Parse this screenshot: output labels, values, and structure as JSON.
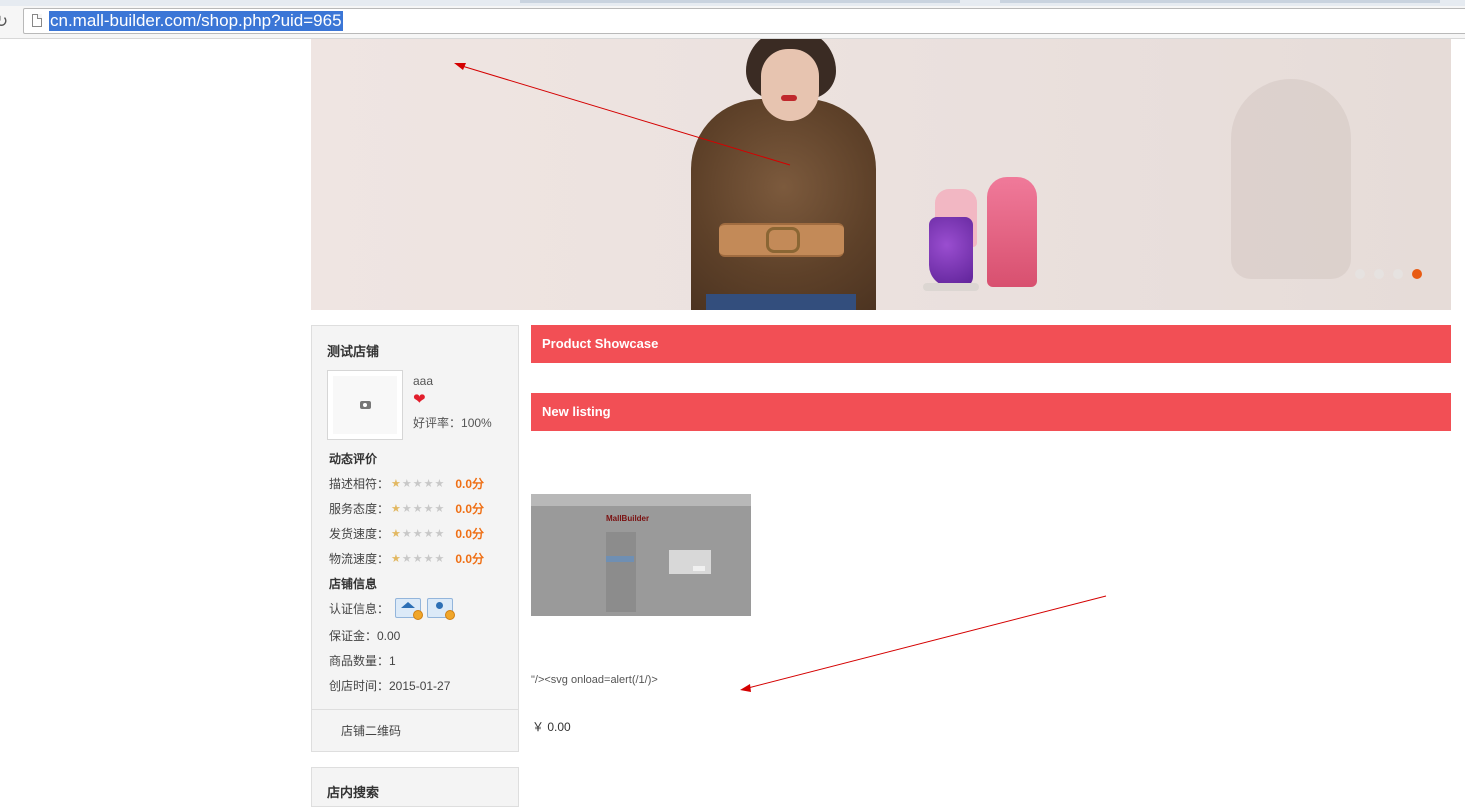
{
  "browser": {
    "url": "cn.mall-builder.com/shop.php?uid=965"
  },
  "banner": {
    "slide_count": 4,
    "active_slide": 4
  },
  "shop": {
    "name": "测试店铺",
    "owner": "aaa",
    "positive_rate_label": "好评率：",
    "positive_rate_value": "100%",
    "dynamic_rating_title": "动态评价",
    "ratings": [
      {
        "label": "描述相符：",
        "score": "0.0分"
      },
      {
        "label": "服务态度：",
        "score": "0.0分"
      },
      {
        "label": "发货速度：",
        "score": "0.0分"
      },
      {
        "label": "物流速度：",
        "score": "0.0分"
      }
    ],
    "info_title": "店铺信息",
    "certification_label": "认证信息：",
    "deposit": "保证金：0.00",
    "product_count": "商品数量：1",
    "created": "创店时间：2015-01-27",
    "qr_code_link": "店铺二维码",
    "next_section_title": "店内搜索"
  },
  "main": {
    "showcase_title": "Product Showcase",
    "new_listing_title": "New listing",
    "products": [
      {
        "thumbnail_logo_text": "MallBuilder",
        "title": "\"/><svg onload=alert(/1/)>",
        "price": "￥ 0.00"
      }
    ]
  },
  "colors": {
    "accent_bar": "#f24f55",
    "score_orange": "#ef6f14",
    "slide_active": "#e85b13",
    "annotation_red": "#d40000"
  }
}
